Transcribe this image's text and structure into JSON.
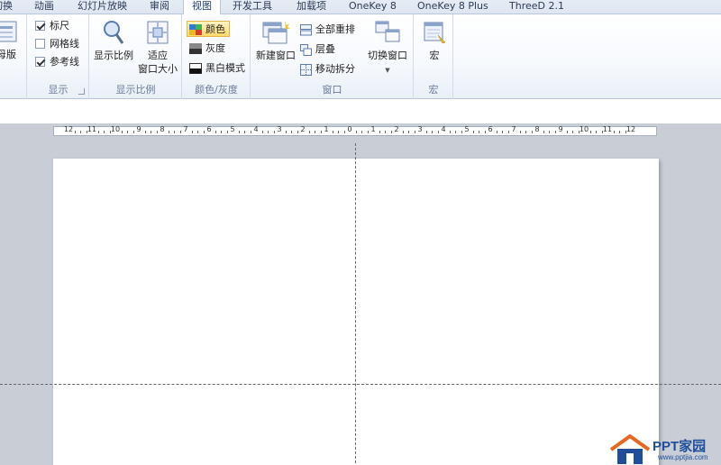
{
  "tabs": [
    {
      "label": "切换"
    },
    {
      "label": "动画"
    },
    {
      "label": "幻灯片放映"
    },
    {
      "label": "审阅"
    },
    {
      "label": "视图",
      "active": true
    },
    {
      "label": "开发工具"
    },
    {
      "label": "加载项"
    },
    {
      "label": "OneKey 8"
    },
    {
      "label": "OneKey 8 Plus"
    },
    {
      "label": "ThreeD 2.1"
    }
  ],
  "ribbon": {
    "master": {
      "label": "母版"
    },
    "show": {
      "label": "显示",
      "ruler": {
        "label": "标尺",
        "checked": true
      },
      "gridlines": {
        "label": "网格线",
        "checked": false
      },
      "guides": {
        "label": "参考线",
        "checked": true
      }
    },
    "zoom": {
      "label": "显示比例",
      "zoom_btn": "显示比例",
      "fit_line1": "适应",
      "fit_line2": "窗口大小"
    },
    "color": {
      "label": "颜色/灰度",
      "color_btn": "颜色",
      "grayscale_btn": "灰度",
      "bw_btn": "黑白模式"
    },
    "window": {
      "label": "窗口",
      "new_window": "新建窗口",
      "arrange_all": "全部重排",
      "cascade": "层叠",
      "move_split": "移动拆分",
      "switch_window": "切换窗口"
    },
    "macros": {
      "label": "宏",
      "macros_btn": "宏"
    }
  },
  "ruler": {
    "labels": [
      "12",
      "11",
      "10",
      "9",
      "8",
      "7",
      "6",
      "5",
      "4",
      "3",
      "2",
      "1",
      "0",
      "1",
      "2",
      "3",
      "4",
      "5",
      "6",
      "7",
      "8",
      "9",
      "10",
      "11",
      "12"
    ]
  },
  "watermark": {
    "title": "PPT家园",
    "url": "www.pptjia.com"
  },
  "colors": {
    "accent": "#1f4f9a",
    "selected": "#ffd96b",
    "workspace": "#c9ced6"
  }
}
